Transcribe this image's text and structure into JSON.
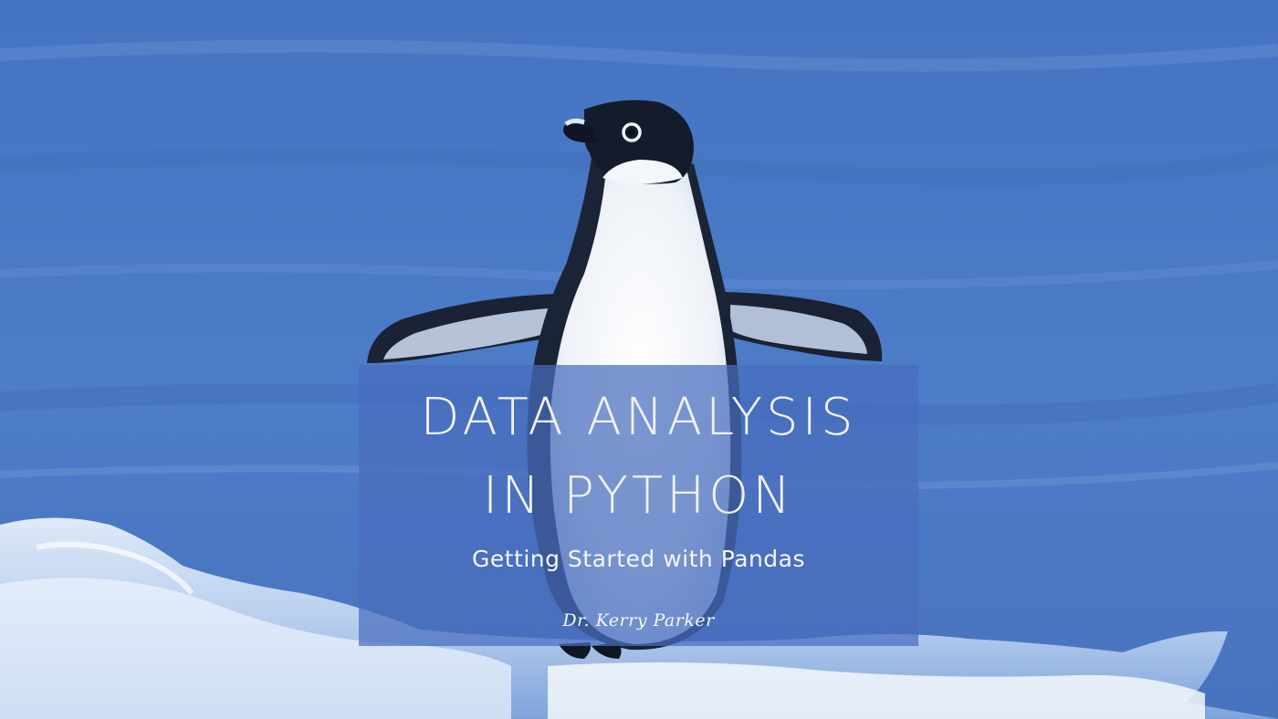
{
  "cover": {
    "title_line1": "DATA ANALYSIS",
    "title_line2": "IN PYTHON",
    "subtitle": "Getting Started with Pandas",
    "author": "Dr. Kerry Parker"
  },
  "colors": {
    "sky": "#4a78c4",
    "panel": "#486ebe",
    "ice": "#e8f1fb",
    "penguin_dark": "#141c2c"
  },
  "icons": [
    "penguin-illustration"
  ]
}
